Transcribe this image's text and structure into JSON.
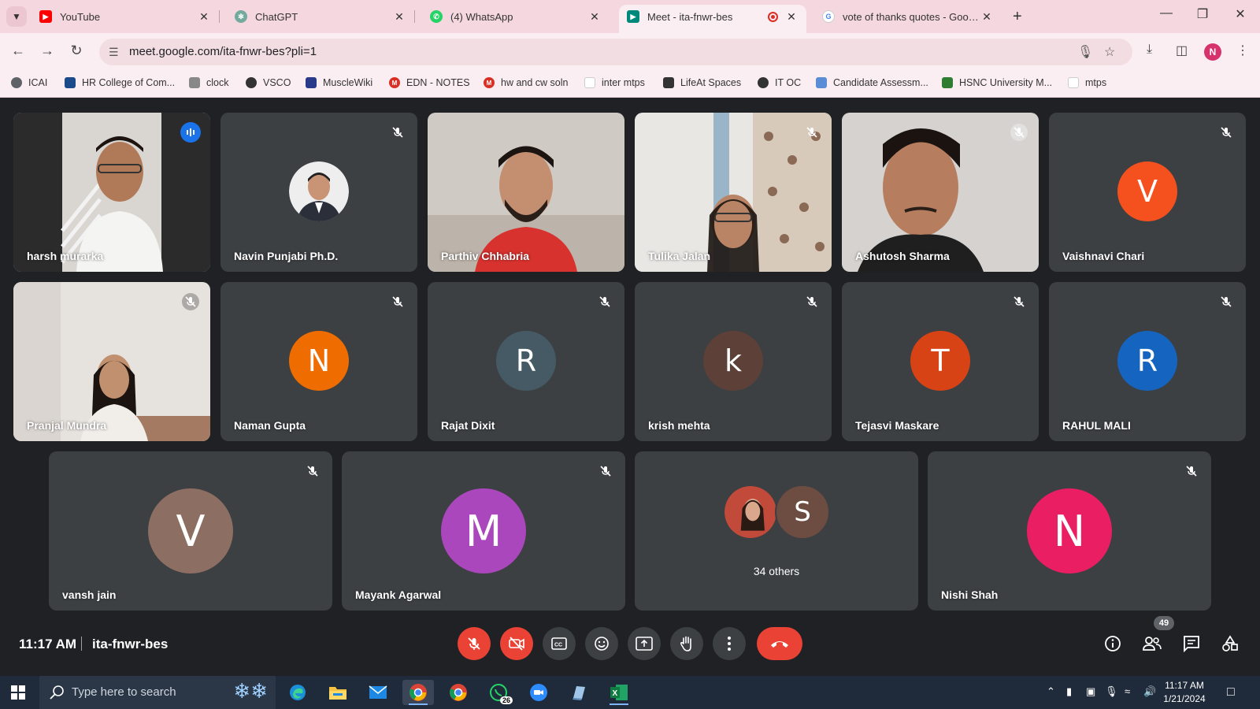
{
  "browser": {
    "tabs": [
      {
        "title": "YouTube",
        "favicon": "youtube-icon",
        "color": "#ff0000"
      },
      {
        "title": "ChatGPT",
        "favicon": "chatgpt-icon",
        "color": "#74aa9c"
      },
      {
        "title": "(4) WhatsApp",
        "favicon": "whatsapp-icon",
        "color": "#25d366"
      },
      {
        "title": "Meet - ita-fnwr-bes",
        "favicon": "meet-icon",
        "color": "#00897b"
      },
      {
        "title": "vote of thanks quotes - Google",
        "favicon": "google-icon",
        "color": "#4285f4"
      }
    ],
    "url": "meet.google.com/ita-fnwr-bes?pli=1",
    "profile_initial": "N",
    "bookmarks": [
      {
        "label": "ICAI",
        "color": "#5f6368"
      },
      {
        "label": "HR College of Com...",
        "color": "#1a4a8a"
      },
      {
        "label": "clock",
        "color": "#888888"
      },
      {
        "label": "VSCO",
        "color": "#333333"
      },
      {
        "label": "MuscleWiki",
        "color": "#2a3a8a"
      },
      {
        "label": "EDN - NOTES",
        "color": "#d93025"
      },
      {
        "label": "hw and cw soln",
        "color": "#d93025"
      },
      {
        "label": "inter mtps",
        "color": "#cccccc"
      },
      {
        "label": "LifeAt Spaces",
        "color": "#333333"
      },
      {
        "label": "IT OC",
        "color": "#333333"
      },
      {
        "label": "Candidate Assessm...",
        "color": "#5b8dd6"
      },
      {
        "label": "HSNC University M...",
        "color": "#2e7d32"
      },
      {
        "label": "mtps",
        "color": "#cccccc"
      }
    ]
  },
  "meet": {
    "participants": [
      {
        "name": "harsh murarka",
        "type": "video",
        "speaking": true
      },
      {
        "name": "Navin Punjabi Ph.D.",
        "type": "photo"
      },
      {
        "name": "Parthiv Chhabria",
        "type": "video"
      },
      {
        "name": "Tulika Jalan",
        "type": "video"
      },
      {
        "name": "Ashutosh Sharma",
        "type": "video"
      },
      {
        "name": "Vaishnavi Chari",
        "type": "avatar",
        "initial": "V",
        "color": "#f4511e"
      },
      {
        "name": "Pranjal Mundra",
        "type": "video"
      },
      {
        "name": "Naman Gupta",
        "type": "avatar",
        "initial": "N",
        "color": "#ef6c00"
      },
      {
        "name": "Rajat Dixit",
        "type": "avatar",
        "initial": "R",
        "color": "#455a64"
      },
      {
        "name": "krish mehta",
        "type": "avatar",
        "initial": "k",
        "color": "#5d4037"
      },
      {
        "name": "Tejasvi Maskare",
        "type": "avatar",
        "initial": "T",
        "color": "#d84315"
      },
      {
        "name": "RAHUL MALI",
        "type": "avatar",
        "initial": "R",
        "color": "#1565c0"
      },
      {
        "name": "vansh jain",
        "type": "avatar",
        "initial": "V",
        "color": "#8d6e63"
      },
      {
        "name": "Mayank Agarwal",
        "type": "avatar",
        "initial": "M",
        "color": "#ab47bc"
      },
      {
        "name": "Nishi Shah",
        "type": "avatar",
        "initial": "N",
        "color": "#e91e63"
      }
    ],
    "others": {
      "label": "34 others",
      "initial": "S",
      "color": "#6d4c41"
    },
    "time": "11:17 AM",
    "meeting_code": "ita-fnwr-bes",
    "participant_count": "49",
    "controls": [
      "mic-off-icon",
      "camera-off-icon",
      "captions-icon",
      "emoji-icon",
      "present-icon",
      "raise-hand-icon",
      "more-options-icon",
      "end-call-icon"
    ]
  },
  "taskbar": {
    "search_placeholder": "Type here to search",
    "whatsapp_badge": "26",
    "clock_time": "11:17 AM",
    "clock_date": "1/21/2024"
  }
}
